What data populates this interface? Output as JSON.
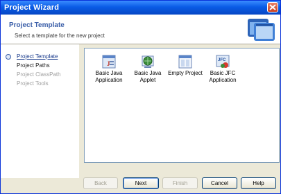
{
  "window": {
    "title": "Project Wizard"
  },
  "header": {
    "title": "Project Template",
    "subtitle": "Select a template for the new project"
  },
  "sidebar": {
    "items": [
      {
        "label": "Project Template",
        "state": "active"
      },
      {
        "label": "Project Paths",
        "state": "normal"
      },
      {
        "label": "Project ClassPath",
        "state": "disabled"
      },
      {
        "label": "Project Tools",
        "state": "disabled"
      }
    ]
  },
  "templates": [
    {
      "label_line1": "Basic Java",
      "label_line2": "Application",
      "icon": "java-application-icon"
    },
    {
      "label_line1": "Basic Java",
      "label_line2": "Applet",
      "icon": "java-applet-icon"
    },
    {
      "label_line1": "Empty Project",
      "label_line2": "",
      "icon": "empty-project-icon"
    },
    {
      "label_line1": "Basic JFC",
      "label_line2": "Application",
      "icon": "jfc-application-icon"
    }
  ],
  "buttons": {
    "back": "Back",
    "next": "Next",
    "finish": "Finish",
    "cancel": "Cancel",
    "help": "Help"
  },
  "colors": {
    "titlebar": "#0a5ce6",
    "header_title": "#3a5ea8",
    "dialog_bg": "#ece9d8"
  }
}
